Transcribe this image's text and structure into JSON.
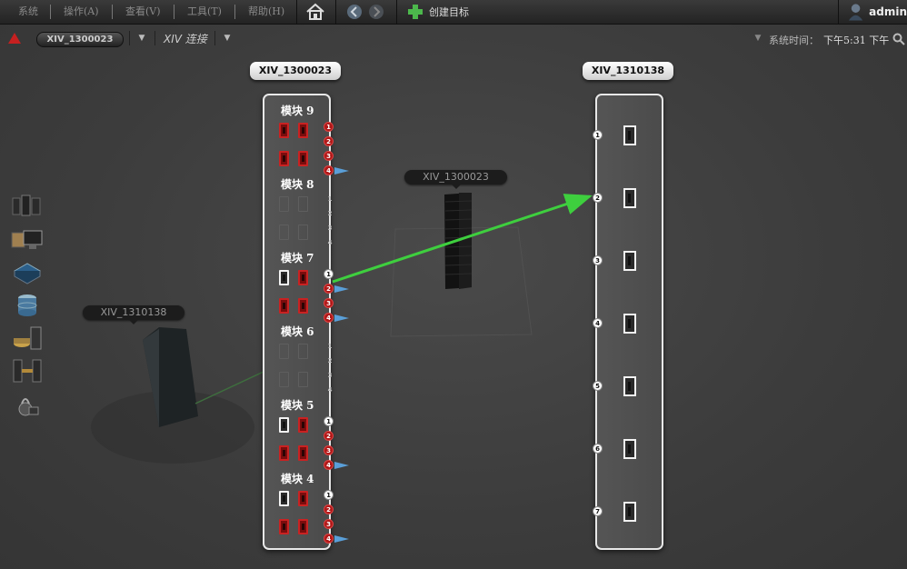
{
  "menu": {
    "items": [
      "系统",
      "操作(A)",
      "查看(V)",
      "工具(T)",
      "帮助(H)"
    ],
    "home_icon": "home-icon",
    "back_icon": "back-arrow-icon",
    "forward_icon": "forward-arrow-icon",
    "create_target_label": "创建目标",
    "create_target_icon": "plus-icon",
    "user_icon": "user-icon",
    "user_name": "admin"
  },
  "subbar": {
    "alert_icon": "warning-triangle-icon",
    "system_selector": "XIV_1300023",
    "view_label": "XIV 连接",
    "system_time_label": "系统时间：",
    "system_time_value": "下午5:31 下午",
    "search_icon": "search-icon"
  },
  "sidebar_icons": [
    "storage-systems-icon",
    "hosts-icon",
    "volumes-icon",
    "pools-icon",
    "remote-icon",
    "connectivity-icon",
    "access-icon"
  ],
  "diagram": {
    "source_system": "XIV_1300023",
    "target_system": "XIV_1310138",
    "left_bubble": "XIV_1310138",
    "center_bubble": "XIV_1300023",
    "modules": [
      {
        "label": "模块 9",
        "ports": [
          "red",
          "red",
          "red",
          "red"
        ],
        "port_numbers": [
          "1",
          "2",
          "3",
          "4"
        ],
        "active": true
      },
      {
        "label": "模块 8",
        "ports": [
          "dim",
          "dim",
          "dim",
          "dim"
        ],
        "port_numbers": [
          "1",
          "2",
          "3",
          "4"
        ],
        "active": false
      },
      {
        "label": "模块 7",
        "ports": [
          "white",
          "red",
          "red",
          "red"
        ],
        "port_numbers": [
          "1",
          "2",
          "3",
          "4"
        ],
        "active": true
      },
      {
        "label": "模块 6",
        "ports": [
          "dim",
          "dim",
          "dim",
          "dim"
        ],
        "port_numbers": [
          "1",
          "2",
          "3",
          "4"
        ],
        "active": false
      },
      {
        "label": "模块 5",
        "ports": [
          "white",
          "red",
          "red",
          "red"
        ],
        "port_numbers": [
          "1",
          "2",
          "3",
          "4"
        ],
        "active": true
      },
      {
        "label": "模块 4",
        "ports": [
          "white",
          "red",
          "red",
          "red"
        ],
        "port_numbers": [
          "1",
          "2",
          "3",
          "4"
        ],
        "active": true
      }
    ],
    "target_ports": [
      "1",
      "2",
      "3",
      "4",
      "5",
      "6",
      "7"
    ],
    "connection": {
      "from_module": "模块 7",
      "from_port": "2",
      "to_port": "2",
      "color": "#3ecf3e"
    },
    "colors": {
      "port_error": "#c92222",
      "port_ok": "#f2f2f2",
      "link": "#3ecf3e"
    }
  }
}
